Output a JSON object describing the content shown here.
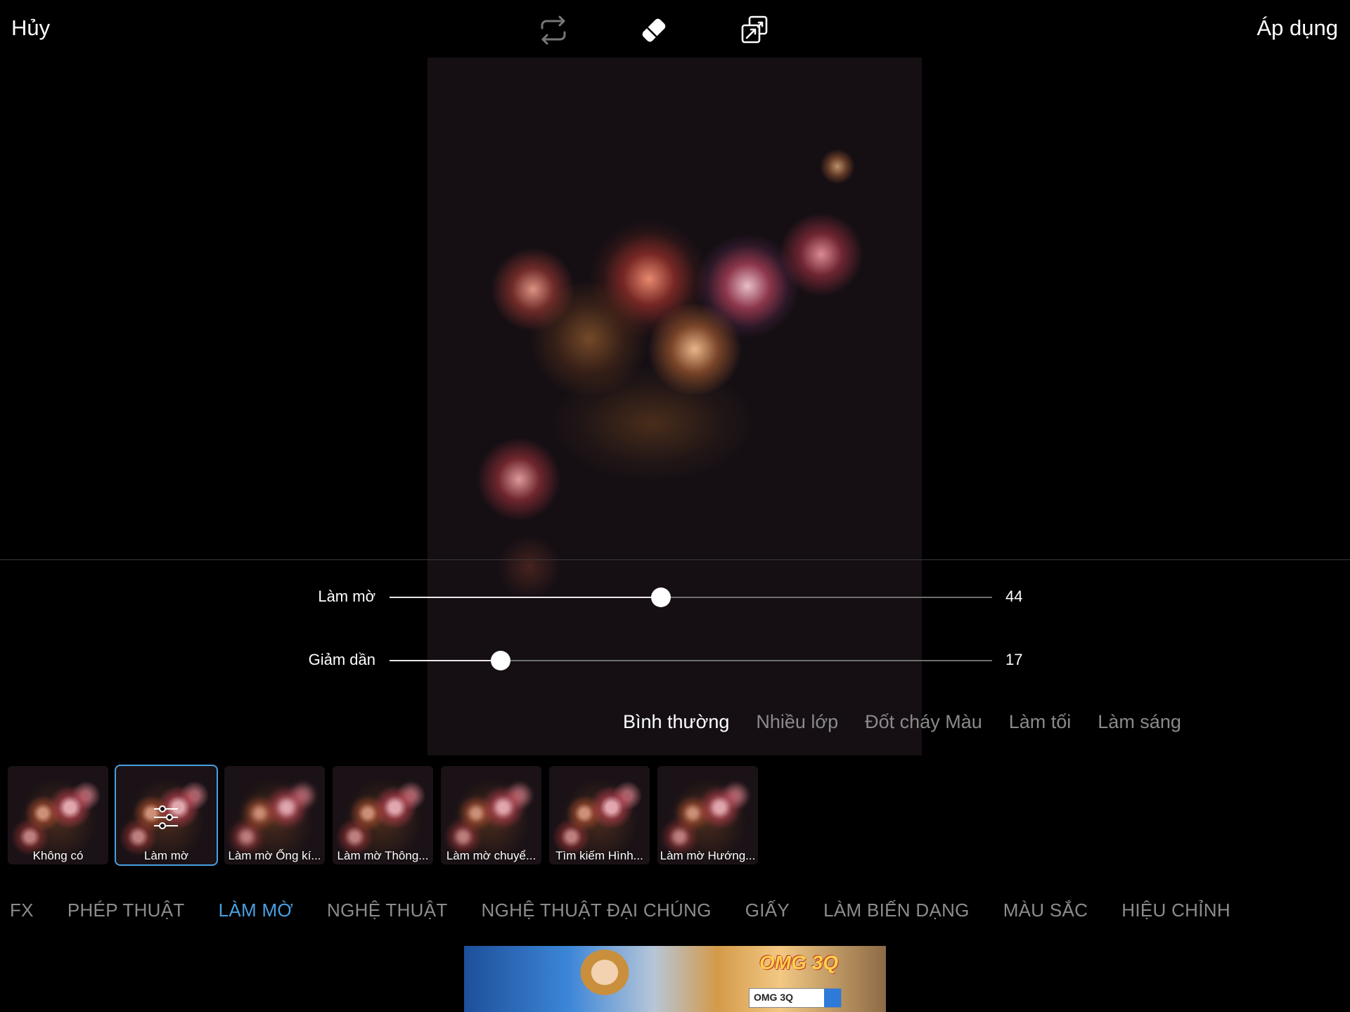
{
  "topbar": {
    "cancel_label": "Hủy",
    "apply_label": "Áp dụng",
    "tools": [
      "repeat-icon",
      "eraser-icon",
      "layer-swap-icon"
    ]
  },
  "sliders": [
    {
      "label": "Làm mờ",
      "value": "44",
      "fraction": 0.45
    },
    {
      "label": "Giảm dần",
      "value": "17",
      "fraction": 0.184
    }
  ],
  "blend_modes": [
    {
      "label": "Bình thường",
      "active": true
    },
    {
      "label": "Nhiều lớp",
      "active": false
    },
    {
      "label": "Đốt cháy Màu",
      "active": false
    },
    {
      "label": "Làm tối",
      "active": false
    },
    {
      "label": "Làm sáng",
      "active": false
    }
  ],
  "effects": [
    {
      "label": "Không có",
      "selected": false
    },
    {
      "label": "Làm mờ",
      "selected": true
    },
    {
      "label": "Làm mờ Ống kí...",
      "selected": false
    },
    {
      "label": "Làm mờ Thông...",
      "selected": false
    },
    {
      "label": "Làm mờ chuyể...",
      "selected": false
    },
    {
      "label": "Tìm kiếm Hình...",
      "selected": false
    },
    {
      "label": "Làm mờ Hướng...",
      "selected": false
    }
  ],
  "categories": [
    {
      "label": "FX",
      "active": false
    },
    {
      "label": "PHÉP THUẬT",
      "active": false
    },
    {
      "label": "LÀM MỜ",
      "active": true
    },
    {
      "label": "NGHỆ THUẬT",
      "active": false
    },
    {
      "label": "NGHỆ THUẬT ĐẠI CHÚNG",
      "active": false
    },
    {
      "label": "GIẤY",
      "active": false
    },
    {
      "label": "LÀM BIẾN DẠNG",
      "active": false
    },
    {
      "label": "MÀU SẮC",
      "active": false
    },
    {
      "label": "HIỆU CHỈNH",
      "active": false
    }
  ],
  "ad": {
    "logo": "OMG 3Q",
    "search_text": "OMG 3Q"
  },
  "colors": {
    "accent": "#4a9fe0",
    "background": "#000000",
    "inactive_text": "#8c8c8c"
  }
}
